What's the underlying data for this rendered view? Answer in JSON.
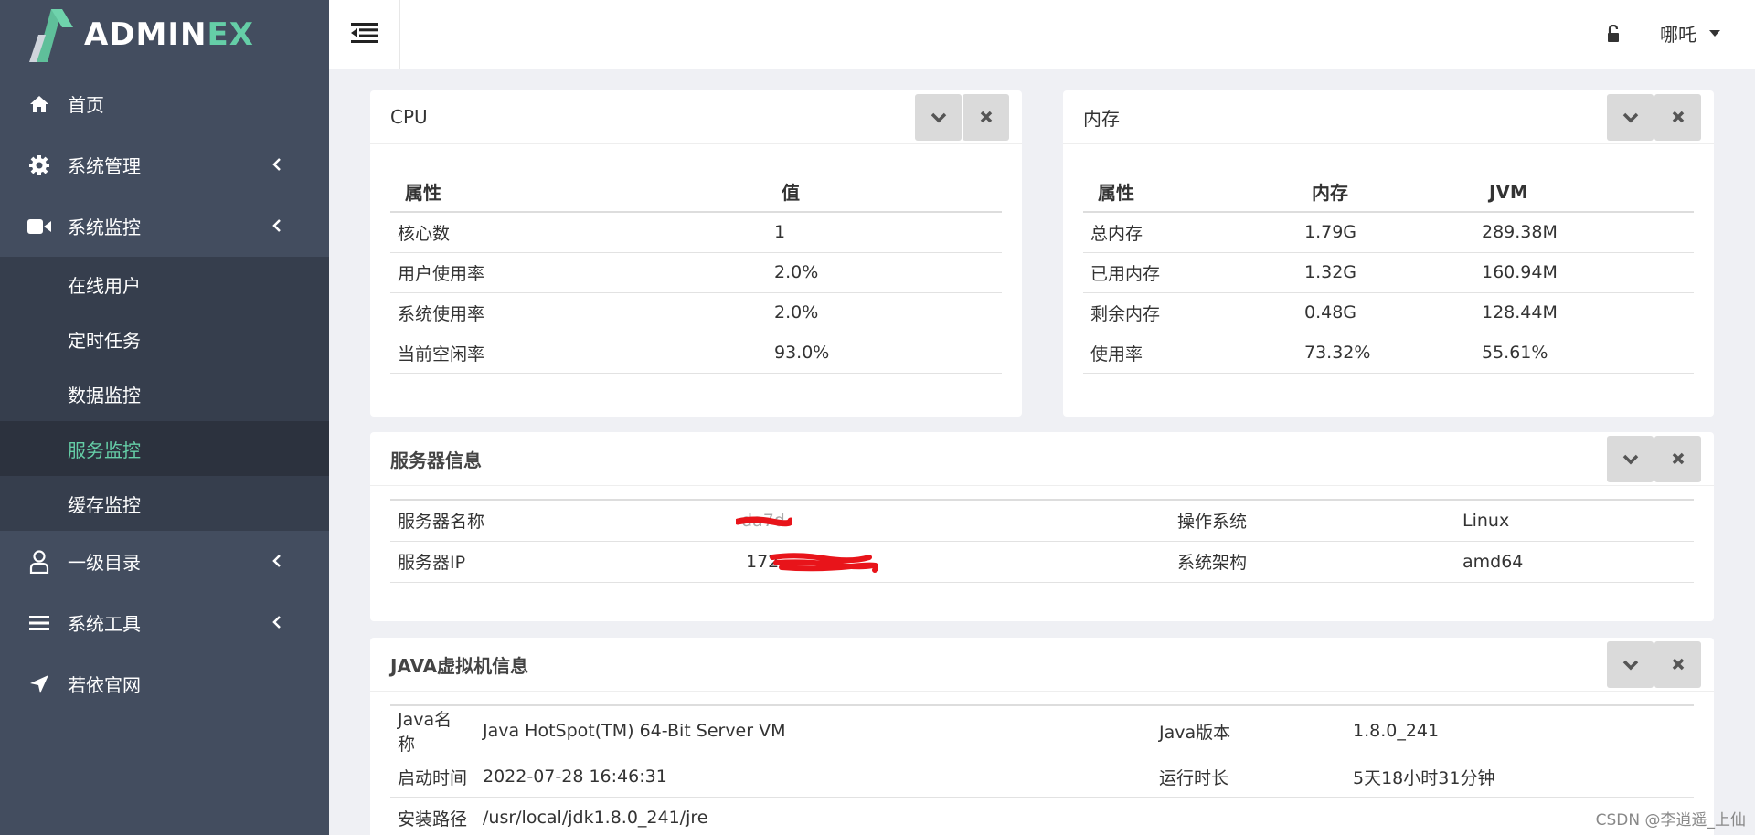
{
  "brand": {
    "part1": "ADMIN",
    "part2": "EX"
  },
  "sidebar": {
    "items": [
      {
        "label": "首页",
        "icon": "home-icon"
      },
      {
        "label": "系统管理",
        "icon": "gear-icon"
      },
      {
        "label": "系统监控",
        "icon": "video-icon"
      }
    ],
    "submenu": [
      {
        "label": "在线用户"
      },
      {
        "label": "定时任务"
      },
      {
        "label": "数据监控"
      },
      {
        "label": "服务监控",
        "active": true
      },
      {
        "label": "缓存监控"
      }
    ],
    "items2": [
      {
        "label": "一级目录",
        "icon": "user-icon"
      },
      {
        "label": "系统工具",
        "icon": "bars-icon"
      },
      {
        "label": "若依官网",
        "icon": "location-arrow-icon"
      }
    ]
  },
  "header": {
    "user_name": "哪吒"
  },
  "cpu": {
    "title": "CPU",
    "columns": [
      "属性",
      "值"
    ],
    "rows": [
      [
        "核心数",
        "1"
      ],
      [
        "用户使用率",
        "2.0%"
      ],
      [
        "系统使用率",
        "2.0%"
      ],
      [
        "当前空闲率",
        "93.0%"
      ]
    ]
  },
  "memory": {
    "title": "内存",
    "columns": [
      "属性",
      "内存",
      "JVM"
    ],
    "rows": [
      [
        "总内存",
        "1.79G",
        "289.38M"
      ],
      [
        "已用内存",
        "1.32G",
        "160.94M"
      ],
      [
        "剩余内存",
        "0.48G",
        "128.44M"
      ],
      [
        "使用率",
        "73.32%",
        "55.61%"
      ]
    ]
  },
  "server": {
    "title": "服务器信息",
    "rows": [
      [
        "服务器名称",
        "da7d",
        "操作系统",
        "Linux"
      ],
      [
        "服务器IP",
        "172.",
        "系统架构",
        "amd64"
      ]
    ]
  },
  "jvm": {
    "title": "JAVA虚拟机信息",
    "rows": [
      [
        "Java名称",
        "Java HotSpot(TM) 64-Bit Server VM",
        "Java版本",
        "1.8.0_241"
      ],
      [
        "启动时间",
        "2022-07-28 16:46:31",
        "运行时长",
        "5天18小时31分钟"
      ],
      [
        "安装路径",
        "/usr/local/jdk1.8.0_241/jre",
        "",
        ""
      ]
    ]
  },
  "watermark": "CSDN @李逍遥_上仙",
  "colors": {
    "sidebar": "#434d5f",
    "submenu": "#363e4d",
    "active": "#65cea7",
    "redaction": "#e8141a"
  }
}
